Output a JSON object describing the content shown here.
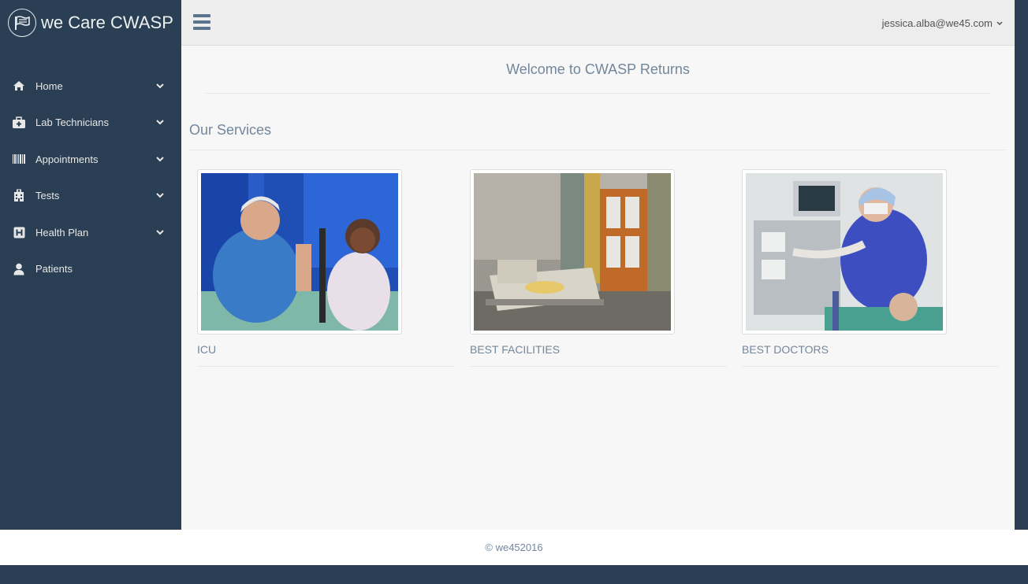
{
  "brand": {
    "title": "we Care CWASP",
    "logo_icon": "flag-icon"
  },
  "sidebar": {
    "items": [
      {
        "label": "Home",
        "icon": "home-icon",
        "has_submenu": true
      },
      {
        "label": "Lab Technicians",
        "icon": "medkit-icon",
        "has_submenu": true
      },
      {
        "label": "Appointments",
        "icon": "barcode-icon",
        "has_submenu": true
      },
      {
        "label": "Tests",
        "icon": "hospital-icon",
        "has_submenu": true
      },
      {
        "label": "Health Plan",
        "icon": "h-square-icon",
        "has_submenu": true
      },
      {
        "label": "Patients",
        "icon": "user-icon",
        "has_submenu": false
      }
    ]
  },
  "topnav": {
    "user_email": "jessica.alba@we45.com"
  },
  "main": {
    "welcome": "Welcome to CWASP Returns",
    "services_title": "Our Services",
    "cards": [
      {
        "caption": "ICU"
      },
      {
        "caption": "BEST FACILITIES"
      },
      {
        "caption": "BEST DOCTORS"
      }
    ]
  },
  "footer": {
    "text": "© we452016"
  },
  "colors": {
    "sidebar_bg": "#2a3f54",
    "content_bg": "#f7f7f7",
    "text_muted": "#73879c",
    "accent": "#5a738e"
  }
}
